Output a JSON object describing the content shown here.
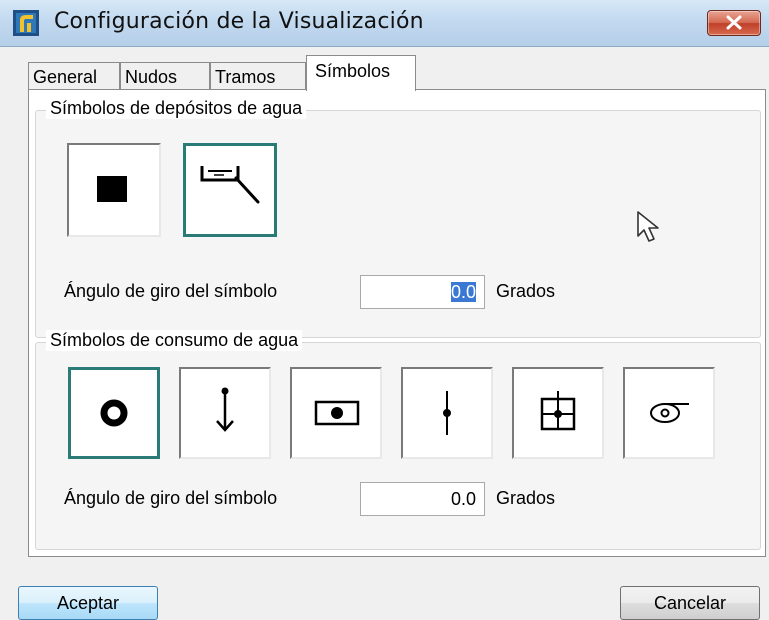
{
  "window": {
    "title": "Configuración de la Visualización"
  },
  "tabs": [
    {
      "label": "General",
      "active": false
    },
    {
      "label": "Nudos",
      "active": false
    },
    {
      "label": "Tramos",
      "active": false
    },
    {
      "label": "Símbolos",
      "active": true
    }
  ],
  "tanks": {
    "title": "Símbolos de depósitos de agua",
    "symbols": [
      {
        "icon": "filled-square-icon",
        "selected": false
      },
      {
        "icon": "water-tank-icon",
        "selected": true
      }
    ],
    "angle_label": "Ángulo de giro del símbolo",
    "angle_value": "0.0",
    "unit": "Grados"
  },
  "consumption": {
    "title": "Símbolos de consumo de agua",
    "symbols": [
      {
        "icon": "ring-node-icon",
        "selected": true
      },
      {
        "icon": "arrow-down-node-icon",
        "selected": false
      },
      {
        "icon": "boxed-node-icon",
        "selected": false
      },
      {
        "icon": "line-node-icon",
        "selected": false
      },
      {
        "icon": "boxed-cross-node-icon",
        "selected": false
      },
      {
        "icon": "spiral-icon",
        "selected": false
      }
    ],
    "angle_label": "Ángulo de giro del símbolo",
    "angle_value": "0.0",
    "unit": "Grados"
  },
  "buttons": {
    "accept": "Aceptar",
    "cancel": "Cancelar"
  },
  "colors": {
    "selected_border": "#2a7a75",
    "selection_highlight": "#3a78d4",
    "close_button": "#c0402a"
  }
}
